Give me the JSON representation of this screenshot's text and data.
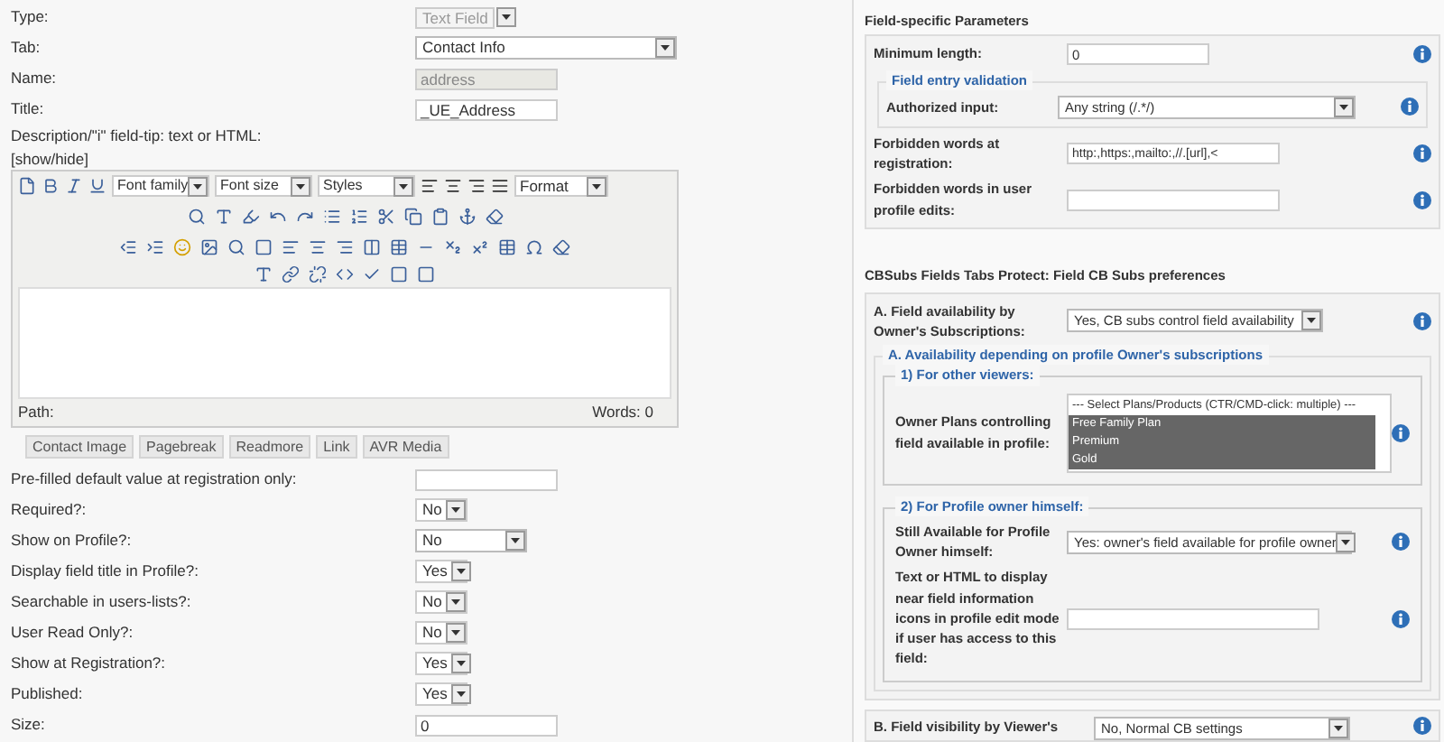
{
  "general_fields": [
    {
      "label": "Type:",
      "kind": "locked-select",
      "value": "Text Field"
    },
    {
      "label": "Tab:",
      "kind": "wide-select",
      "value": "Contact Info"
    },
    {
      "label": "Name:",
      "kind": "locked-text",
      "value": "address"
    },
    {
      "label": "Title:",
      "kind": "text",
      "value": "_UE_Address"
    }
  ],
  "description_label": "Description/\"i\" field-tip: text or HTML:",
  "show_hide": "[show/hide]",
  "editor": {
    "selects": [
      "Font family",
      "Font size",
      "Styles",
      "Format"
    ],
    "path_label": "Path:",
    "words": "Words: 0"
  },
  "editor_buttons": [
    "Contact Image",
    "Pagebreak",
    "Readmore",
    "Link",
    "AVR Media"
  ],
  "options": [
    {
      "label": "Pre-filled default value at registration only:",
      "kind": "text"
    },
    {
      "label": "Required?:",
      "kind": "select",
      "value": "No"
    },
    {
      "label": "Show on Profile?:",
      "kind": "wide-select",
      "value": "No"
    },
    {
      "label": "Display field title in Profile?:",
      "kind": "select",
      "value": "Yes"
    },
    {
      "label": "Searchable in users-lists?:",
      "kind": "select",
      "value": "No"
    },
    {
      "label": "User Read Only?:",
      "kind": "select",
      "value": "No"
    },
    {
      "label": "Show at Registration?:",
      "kind": "select",
      "value": "Yes"
    },
    {
      "label": "Published:",
      "kind": "select",
      "value": "Yes"
    },
    {
      "label": "Size:",
      "kind": "text",
      "value": "0"
    }
  ],
  "field_params": {
    "title": "Field-specific Parameters",
    "min_length": {
      "label": "Minimum length:",
      "value": "0"
    },
    "validation": {
      "legend": "Field entry validation",
      "label": "Authorized input:",
      "value": "Any string (/.*/)"
    },
    "forbidden": [
      {
        "label": "Forbidden words at registration:",
        "value": "http:,https:,mailto:,//.[url],<"
      },
      {
        "label": "Forbidden words in user profile edits:"
      }
    ]
  },
  "cbsubs": {
    "title": "CBSubs Fields Tabs Protect: Field CB Subs preferences",
    "availability": {
      "label": "A. Field availability by Owner's Subscriptions:",
      "value": "Yes, CB subs control field availability"
    },
    "owner_group": {
      "legend": "A. Availability depending on profile Owner's subscriptions",
      "other_viewers": {
        "legend": "1) For other viewers:",
        "label": "Owner Plans controlling field available in profile:",
        "plans": [
          {
            "label": "--- Select Plans/Products (CTR/CMD-click: multiple) ---",
            "selected": false
          },
          {
            "label": "Free Family Plan",
            "selected": true
          },
          {
            "label": "Premium",
            "selected": true
          },
          {
            "label": "Gold",
            "selected": true
          }
        ]
      },
      "owner": {
        "legend": "2) For Profile owner himself:",
        "still_label": "Still Available for Profile Owner himself:",
        "still_value": "Yes: owner's field available for profile owner",
        "text_label": "Text or HTML to display near field information icons in profile edit mode if user has access to this field:"
      }
    },
    "visibility": {
      "label": "B. Field visibility by Viewer's",
      "value": "No, Normal CB settings"
    }
  }
}
